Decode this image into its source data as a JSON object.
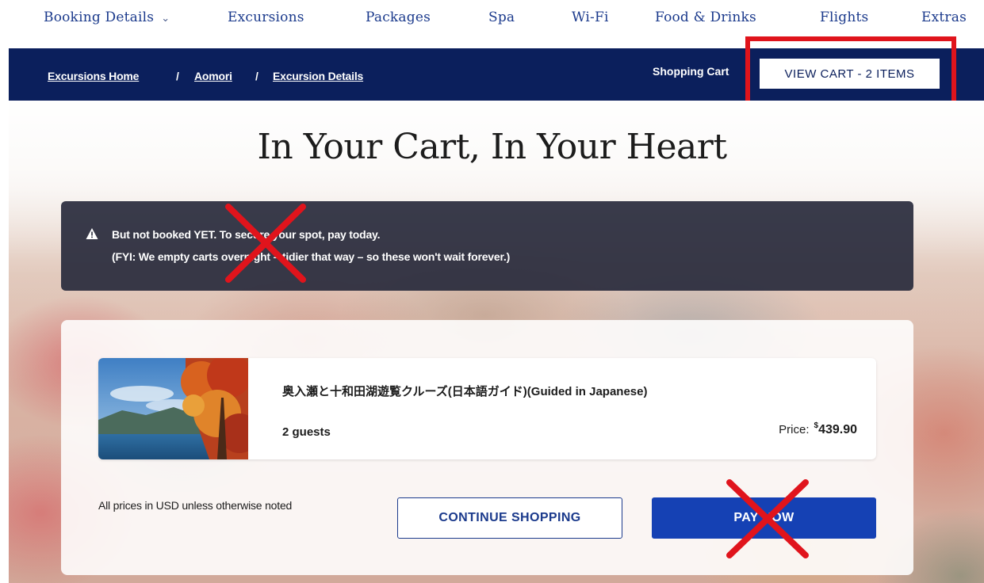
{
  "nav": {
    "items": [
      {
        "label": "Booking Details",
        "has_dropdown": true
      },
      {
        "label": "Excursions"
      },
      {
        "label": "Packages"
      },
      {
        "label": "Spa"
      },
      {
        "label": "Wi-Fi"
      },
      {
        "label": "Food & Drinks"
      },
      {
        "label": "Flights"
      },
      {
        "label": "Extras"
      }
    ],
    "dropdown_icon": "chevron-down-icon"
  },
  "breadcrumb": {
    "items": [
      "Excursions Home",
      "Aomori",
      "Excursion Details"
    ],
    "separator": "/"
  },
  "cart": {
    "label": "Shopping Cart",
    "view_button": "VIEW CART - 2 ITEMS"
  },
  "page": {
    "title": "In Your Cart, In Your Heart"
  },
  "warning": {
    "icon": "warning-triangle-icon",
    "line1": "But not booked YET. To secure your spot, pay today.",
    "line2": "(FYI: We empty carts overnight – tidier that way – so these won't wait forever.)"
  },
  "item": {
    "title": "奥入瀬と十和田湖遊覧クルーズ(日本語ガイド)(Guided in Japanese)",
    "guests": "2 guests",
    "price_label": "Price:",
    "currency": "$",
    "price": "439.90"
  },
  "footer": {
    "usd_note": "All prices in USD unless otherwise noted",
    "continue_button": "CONTINUE SHOPPING",
    "pay_button": "PAY NOW"
  },
  "colors": {
    "nav_text": "#1b3a8c",
    "crumb_bar": "#0b1f5c",
    "pay_button": "#1541b4",
    "annotation_red": "#e0141c"
  }
}
